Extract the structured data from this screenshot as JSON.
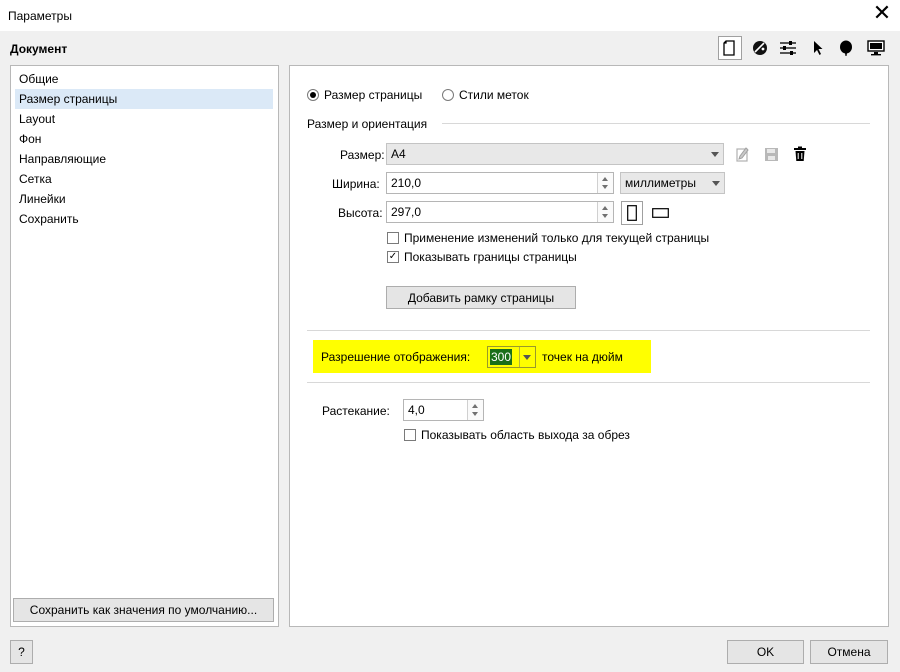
{
  "window": {
    "title": "Параметры",
    "close_glyph": "✕"
  },
  "header": {
    "section_title": "Документ",
    "toolbar_icons": [
      "page-icon",
      "palette-icon",
      "sliders-icon",
      "pointer-icon",
      "balloon-icon",
      "monitor-icon"
    ]
  },
  "sidebar": {
    "items": [
      {
        "label": "Общие"
      },
      {
        "label": "Размер страницы",
        "selected": true
      },
      {
        "label": "Layout"
      },
      {
        "label": "Фон"
      },
      {
        "label": "Направляющие"
      },
      {
        "label": "Сетка"
      },
      {
        "label": "Линейки"
      },
      {
        "label": "Сохранить"
      }
    ],
    "save_defaults_label": "Сохранить как значения по умолчанию..."
  },
  "page": {
    "mode_radio": {
      "page_size_label": "Размер страницы",
      "mark_styles_label": "Стили меток",
      "selected": "page_size"
    },
    "group_label": "Размер и ориентация",
    "size": {
      "label": "Размер:",
      "value": "A4"
    },
    "width": {
      "label": "Ширина:",
      "value": "210,0"
    },
    "height": {
      "label": "Высота:",
      "value": "297,0"
    },
    "units": {
      "value": "миллиметры"
    },
    "apply_current_only": {
      "label": "Применение изменений только для текущей страницы",
      "checked": false
    },
    "show_page_border": {
      "label": "Показывать границы страницы",
      "checked": true
    },
    "add_frame_label": "Добавить рамку страницы",
    "resolution": {
      "label": "Разрешение отображения:",
      "value": "300",
      "unit": "точек на дюйм"
    },
    "bleed": {
      "label": "Растекание:",
      "value": "4,0"
    },
    "show_bleed": {
      "label": "Показывать область выхода за обрез",
      "checked": false
    },
    "check_glyph": "✓"
  },
  "footer": {
    "help_label": "?",
    "ok_label": "OK",
    "cancel_label": "Отмена"
  },
  "colors": {
    "selection": "#dbe9f7",
    "highlight": "#ffff00",
    "resolution_selected": "#1a6f1a"
  }
}
